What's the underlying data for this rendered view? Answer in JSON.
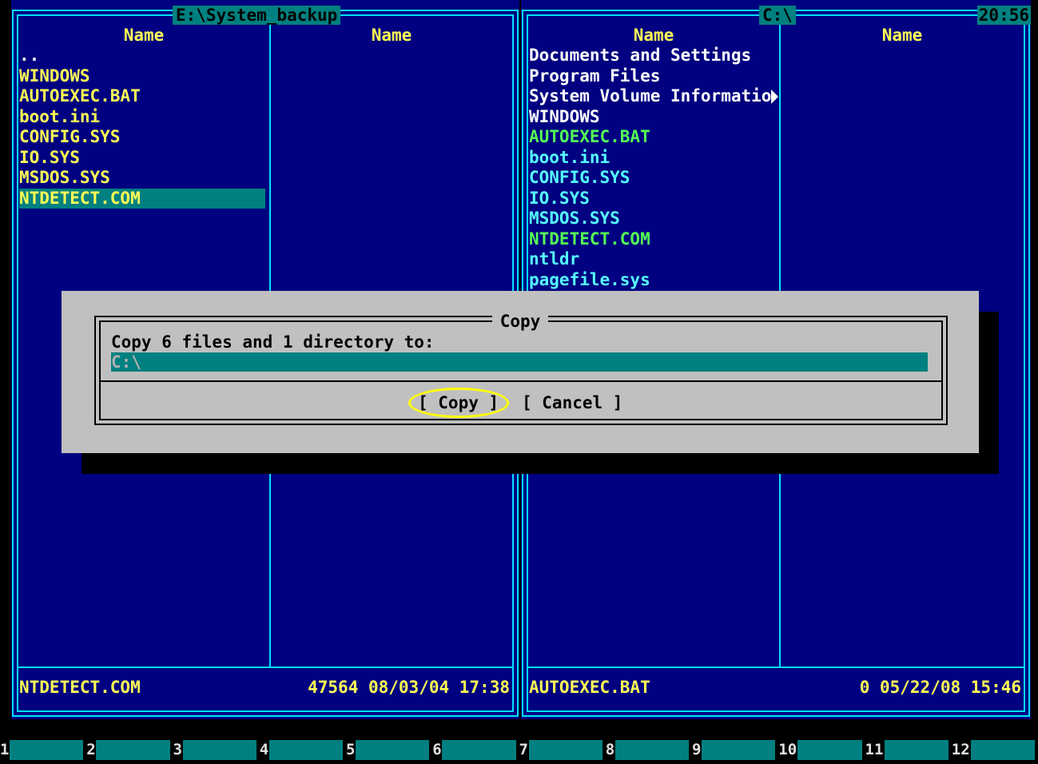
{
  "left_panel": {
    "path": "E:\\System_backup",
    "columns": [
      "Name",
      "Name"
    ],
    "files": [
      {
        "name": "..",
        "kind": "dir"
      },
      {
        "name": "WINDOWS",
        "kind": "file"
      },
      {
        "name": "AUTOEXEC.BAT",
        "kind": "file"
      },
      {
        "name": "boot.ini",
        "kind": "file"
      },
      {
        "name": "CONFIG.SYS",
        "kind": "file"
      },
      {
        "name": "IO.SYS",
        "kind": "file"
      },
      {
        "name": "MSDOS.SYS",
        "kind": "file"
      },
      {
        "name": "NTDETECT.COM",
        "kind": "selected"
      }
    ],
    "status_name": "NTDETECT.COM",
    "status_info": "47564 08/03/04 17:38"
  },
  "right_panel": {
    "path": "C:\\",
    "clock": "20:56",
    "columns": [
      "Name",
      "Name"
    ],
    "files": [
      {
        "name": "Documents and Settings",
        "kind": "dir"
      },
      {
        "name": "Program Files",
        "kind": "dir"
      },
      {
        "name": "System Volume Informatio",
        "kind": "dir"
      },
      {
        "name": "WINDOWS",
        "kind": "dir"
      },
      {
        "name": "AUTOEXEC.BAT",
        "kind": "exec"
      },
      {
        "name": "boot.ini",
        "kind": "sys"
      },
      {
        "name": "CONFIG.SYS",
        "kind": "sys"
      },
      {
        "name": "IO.SYS",
        "kind": "sys"
      },
      {
        "name": "MSDOS.SYS",
        "kind": "sys"
      },
      {
        "name": "NTDETECT.COM",
        "kind": "exec"
      },
      {
        "name": "ntldr",
        "kind": "sys"
      },
      {
        "name": "pagefile.sys",
        "kind": "sys"
      }
    ],
    "status_name": "AUTOEXEC.BAT",
    "status_info": "0 05/22/08 15:46"
  },
  "dialog": {
    "title": "Copy",
    "prompt": "Copy 6 files and 1 directory to:",
    "destination": "C:\\",
    "copy_label": "[ Copy ]",
    "cancel_label": "[ Cancel ]"
  },
  "function_keys": [
    "1",
    "2",
    "3",
    "4",
    "5",
    "6",
    "7",
    "8",
    "9",
    "10",
    "11",
    "12"
  ],
  "colors": {
    "panel_bg": "#000080",
    "frame": "#00e0ff",
    "highlight": "#008080",
    "file_yellow": "#ffff55",
    "exec_green": "#55ff55",
    "sys_cyan": "#55ffff",
    "dialog_bg": "#c0c0c0",
    "focus_ring": "#ffff00"
  }
}
